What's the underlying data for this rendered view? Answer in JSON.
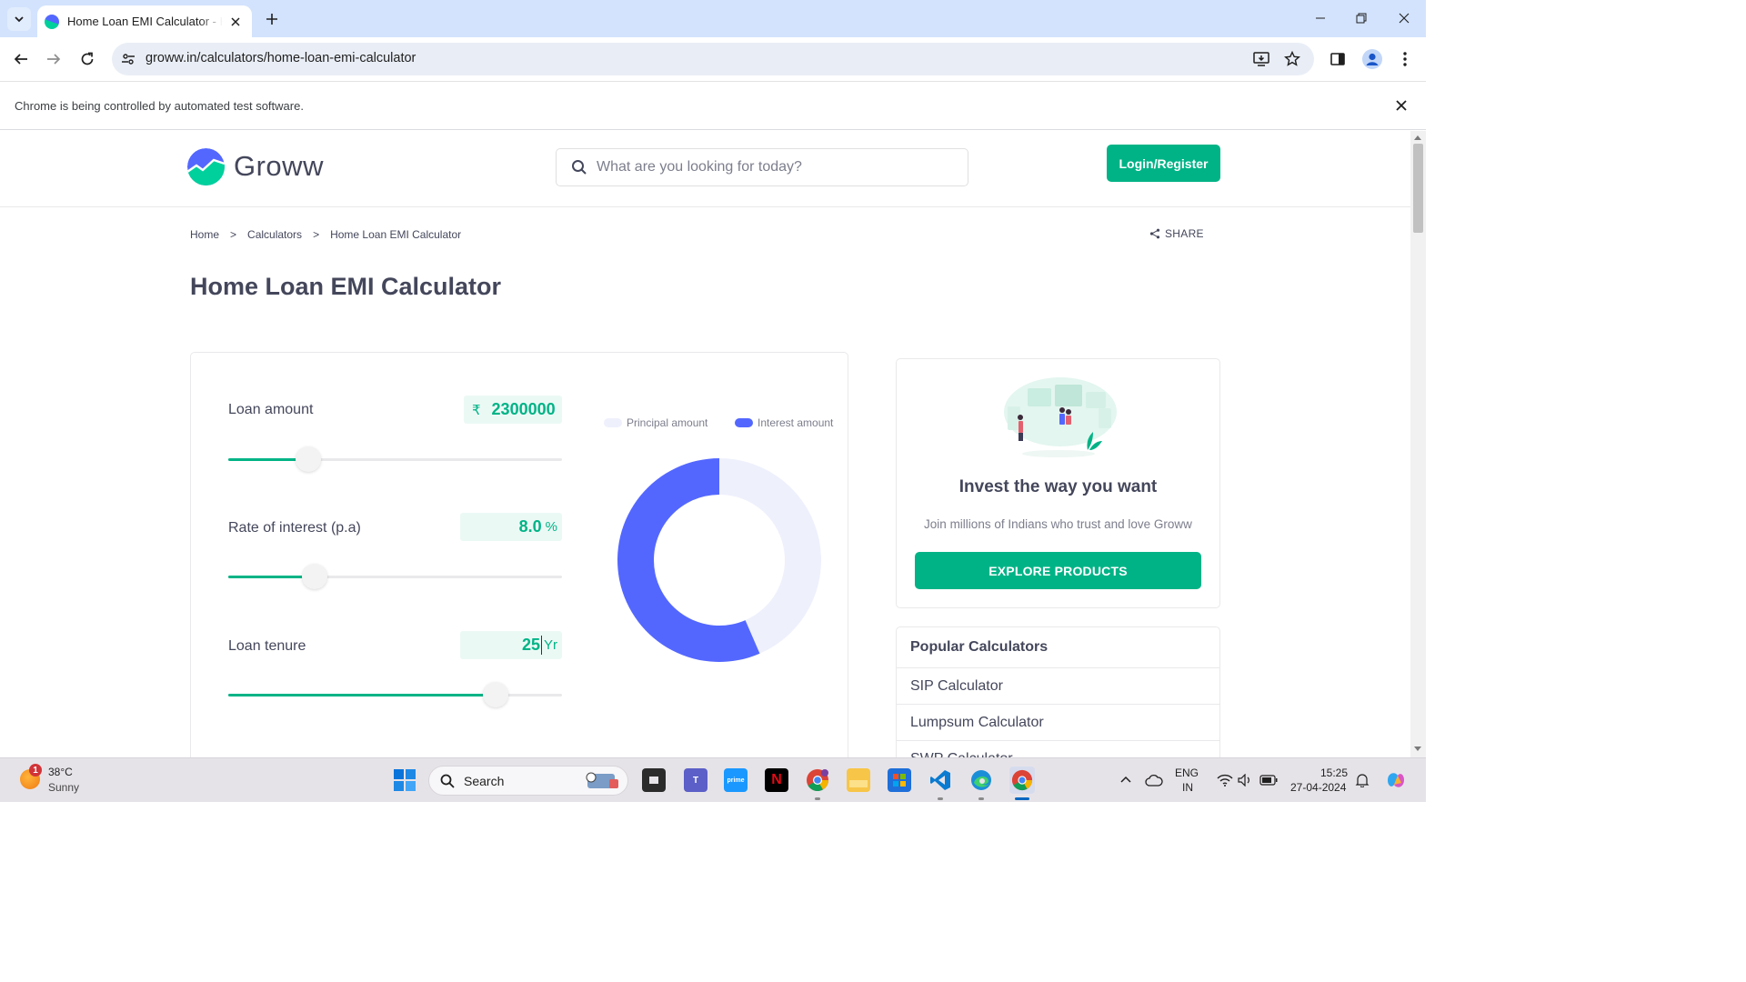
{
  "browser": {
    "tab_title": "Home Loan EMI Calculator - Home Loan EMI Calculator",
    "url": "groww.in/calculators/home-loan-emi-calculator",
    "infobar_text": "Chrome is being controlled by automated test software."
  },
  "site": {
    "logo_text": "Groww",
    "search_placeholder": "What are you looking for today?",
    "login_label": "Login/Register"
  },
  "breadcrumb": {
    "items": [
      "Home",
      "Calculators",
      "Home Loan EMI Calculator"
    ],
    "separator": ">"
  },
  "share_label": "SHARE",
  "page_title": "Home Loan EMI Calculator",
  "calculator": {
    "loan_amount": {
      "label": "Loan amount",
      "prefix": "₹",
      "value": "2300000",
      "slider_fraction": 0.24
    },
    "interest_rate": {
      "label": "Rate of interest (p.a)",
      "value": "8.0",
      "suffix": "%",
      "slider_fraction": 0.26
    },
    "tenure": {
      "label": "Loan tenure",
      "value": "25",
      "suffix": "Yr",
      "slider_fraction": 0.8
    }
  },
  "chart_data": {
    "type": "pie",
    "style": "donut",
    "labels": [
      "Principal amount",
      "Interest amount"
    ],
    "values": [
      43.5,
      56.5
    ],
    "unit": "percent",
    "colors": [
      "#eef0fc",
      "#5367ff"
    ],
    "legend_position": "top"
  },
  "promo": {
    "title": "Invest the way you want",
    "subtitle": "Join millions of Indians who trust and love Groww",
    "button_label": "EXPLORE PRODUCTS"
  },
  "popular_calculators": {
    "heading": "Popular Calculators",
    "items": [
      "SIP Calculator",
      "Lumpsum Calculator",
      "SWP Calculator"
    ]
  },
  "taskbar": {
    "weather_badge": "1",
    "temperature": "38°C",
    "condition": "Sunny",
    "search_label": "Search",
    "language_top": "ENG",
    "language_bottom": "IN",
    "time": "15:25",
    "date": "27-04-2024"
  },
  "colors": {
    "brand_green": "#00b386",
    "interest_blue": "#5367ff",
    "principal_light": "#eef0fc",
    "text_dark": "#44475b"
  }
}
